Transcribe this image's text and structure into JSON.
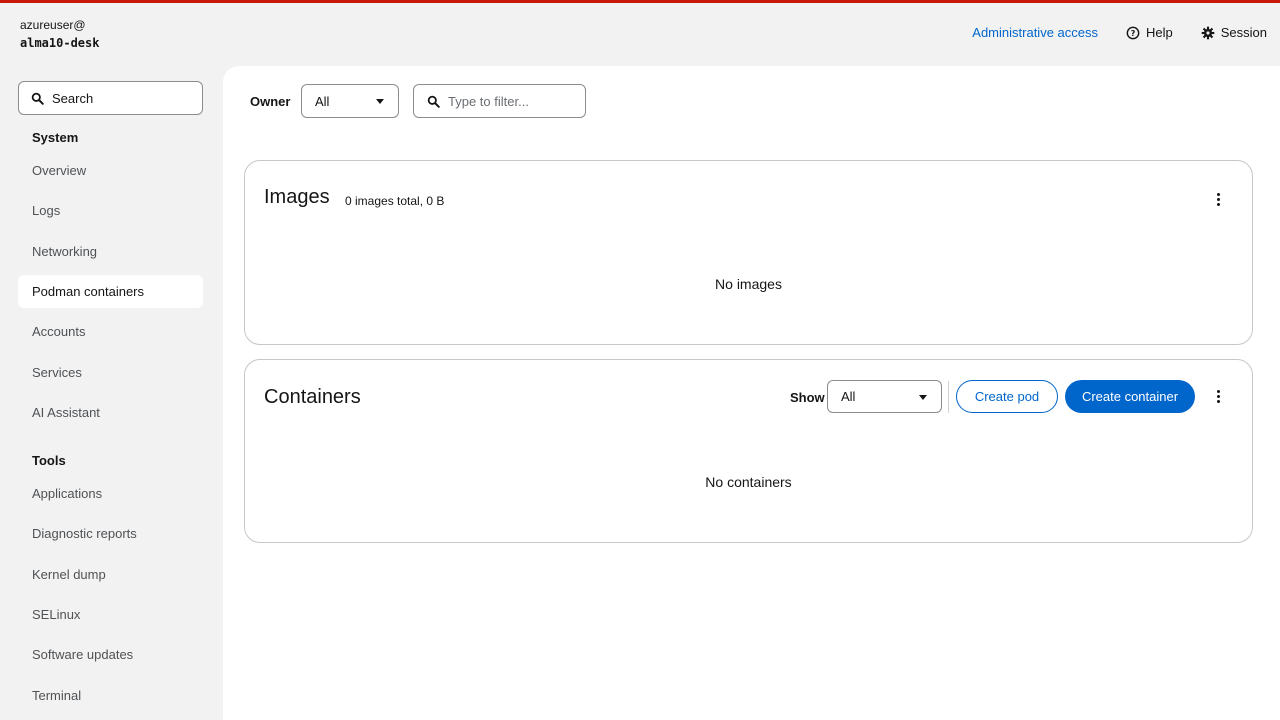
{
  "host": {
    "user": "azureuser@",
    "name": "alma10-desk"
  },
  "topbar": {
    "admin_access": "Administrative access",
    "help": "Help",
    "session": "Session"
  },
  "sidebar": {
    "search_placeholder": "Search",
    "system_label": "System",
    "system_items": [
      {
        "label": "Overview"
      },
      {
        "label": "Logs"
      },
      {
        "label": "Networking"
      },
      {
        "label": "Podman containers",
        "active": true
      },
      {
        "label": "Accounts"
      },
      {
        "label": "Services"
      },
      {
        "label": "AI Assistant"
      }
    ],
    "tools_label": "Tools",
    "tools_items": [
      {
        "label": "Applications"
      },
      {
        "label": "Diagnostic reports"
      },
      {
        "label": "Kernel dump"
      },
      {
        "label": "SELinux"
      },
      {
        "label": "Software updates"
      },
      {
        "label": "Terminal"
      }
    ]
  },
  "filters": {
    "owner_label": "Owner",
    "owner_value": "All",
    "filter_placeholder": "Type to filter..."
  },
  "images": {
    "title": "Images",
    "summary": "0 images total, 0 B",
    "empty": "No images"
  },
  "containers": {
    "title": "Containers",
    "show_label": "Show",
    "show_value": "All",
    "create_pod": "Create pod",
    "create_container": "Create container",
    "empty": "No containers"
  },
  "colors": {
    "accent": "#0066cc",
    "top_border": "#c9190b",
    "background": "#f2f2f2"
  }
}
